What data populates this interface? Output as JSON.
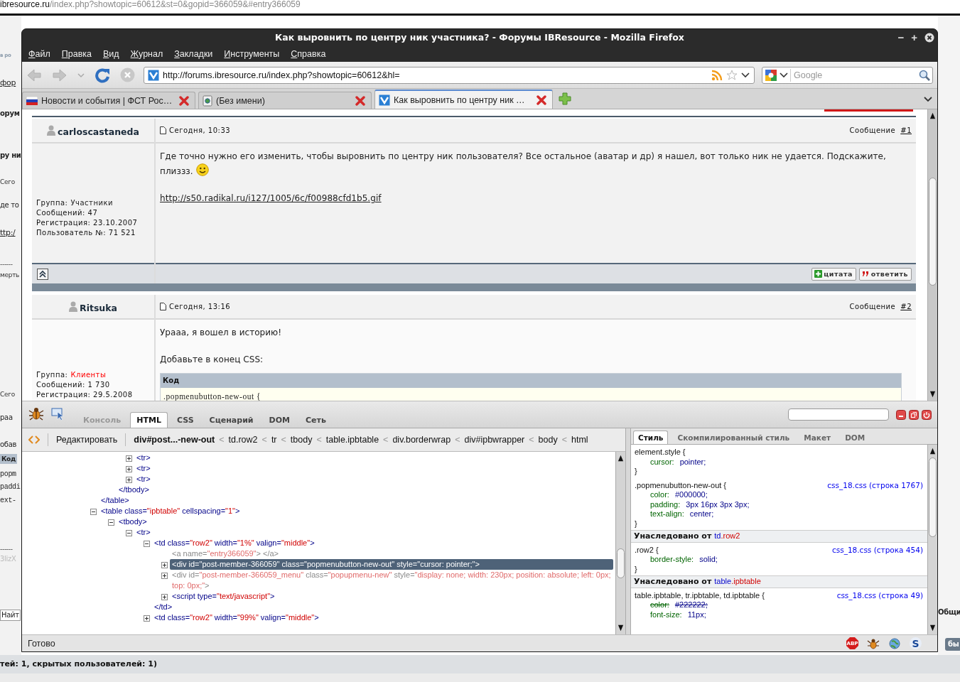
{
  "background_page": {
    "address": {
      "host": "ibresource.ru",
      "path": "/index.php?showtopic=60612&st=0&gopid=366059&#entry366059"
    },
    "left_fragments": [
      {
        "kind": "logo",
        "text": "в ро"
      },
      {
        "kind": "link",
        "text": "фор"
      },
      {
        "kind": "heading",
        "text": "орум"
      },
      {
        "kind": "heading",
        "text": "ру ни"
      },
      {
        "kind": "small",
        "text": "Сего"
      },
      {
        "kind": "text",
        "text": "де то"
      },
      {
        "kind": "link",
        "text": "ttp:/"
      },
      {
        "kind": "small",
        "text": "------"
      },
      {
        "kind": "small",
        "text": "мерть"
      },
      {
        "kind": "small",
        "text": "Сего"
      },
      {
        "kind": "text",
        "text": "раа"
      },
      {
        "kind": "text",
        "text": "обав"
      },
      {
        "kind": "codehead",
        "text": "Код"
      },
      {
        "kind": "mono",
        "text": "popm"
      },
      {
        "kind": "mono",
        "text": "paddi"
      },
      {
        "kind": "mono",
        "text": "ext-"
      },
      {
        "kind": "small",
        "text": "------"
      },
      {
        "kind": "faint",
        "text": "3lizX"
      },
      {
        "kind": "field",
        "text": "Найт"
      }
    ],
    "right_fragments": [
      {
        "kind": "heading",
        "text": "Общи"
      },
      {
        "kind": "button",
        "text": "бы"
      }
    ],
    "footer_text": "тей: 1, скрытых пользователей: 1)"
  },
  "window": {
    "title": "Как выровнить по центру ник участника? - Форумы IBResource - Mozilla Firefox",
    "controls": [
      "−",
      "+"
    ]
  },
  "menu": [
    "Файл",
    "Правка",
    "Вид",
    "Журнал",
    "Закладки",
    "Инструменты",
    "Справка"
  ],
  "toolbar": {
    "nav_buttons": [
      {
        "kind": "back",
        "disabled": true
      },
      {
        "kind": "forward",
        "disabled": true
      },
      {
        "kind": "history",
        "disabled": true
      },
      {
        "kind": "reload",
        "disabled": false
      },
      {
        "kind": "stop",
        "disabled": true
      }
    ],
    "url": "http://forums.ibresource.ru/index.php?showtopic=60612&hl=",
    "search": {
      "placeholder": "Google"
    }
  },
  "tabs": [
    {
      "kind": "flag",
      "label": "Новости и события | ФСТ Рос…",
      "selected": false
    },
    {
      "kind": "page",
      "label": "(Без имени)",
      "selected": false
    },
    {
      "kind": "site",
      "label": "Как выровнить по центру ник …",
      "selected": true
    }
  ],
  "forum": {
    "posts": [
      {
        "author": "carloscastaneda",
        "time": "Сегодня, 10:33",
        "number_label": "Сообщение",
        "number": "#1",
        "group": {
          "label": "Группа:",
          "value": "Участники",
          "color": "#222222"
        },
        "stats": [
          "Сообщений: 47",
          "Регистрация: 23.10.2007",
          "Пользователь №: 71 521"
        ],
        "body": [
          {
            "kind": "text",
            "text": "Где точно нужно его изменить, чтобы выровнить по центру ник пользователя? Все остальное (аватар и др) я нашел, вот только ник не удается. Подскажите, плиззз.",
            "smiley": true
          },
          {
            "kind": "link",
            "text": "http://s50.radikal.ru/i127/1005/6c/f00988cfd1b5.gif"
          }
        ],
        "actions": [
          {
            "kind": "quote",
            "label": "цитата"
          },
          {
            "kind": "reply",
            "label": "ответить"
          }
        ]
      },
      {
        "author": "Ritsuka",
        "time": "Сегодня, 13:16",
        "number_label": "Сообщение",
        "number": "#2",
        "group": {
          "label": "Группа:",
          "value": "Клиенты",
          "color": "#ff0000"
        },
        "stats": [
          "Сообщений: 1 730",
          "Регистрация: 29.5.2008"
        ],
        "body": [
          {
            "kind": "text",
            "text": "Урааа, я вошел в историю!"
          },
          {
            "kind": "text",
            "text": "Добавьте в конец CSS:"
          },
          {
            "kind": "code",
            "title": "Код",
            "lines": [
              ".popmenubutton-new-out {"
            ]
          }
        ]
      }
    ]
  },
  "firebug": {
    "tabs": [
      {
        "label": "Консоль",
        "selected": false,
        "disabled": true
      },
      {
        "label": "HTML",
        "selected": true,
        "disabled": false
      },
      {
        "label": "CSS",
        "selected": false,
        "disabled": false
      },
      {
        "label": "Сценарий",
        "selected": false,
        "disabled": false
      },
      {
        "label": "DOM",
        "selected": false,
        "disabled": false
      },
      {
        "label": "Сеть",
        "selected": false,
        "disabled": false
      }
    ],
    "edit_button": "Редактировать",
    "breadcrumbs": [
      {
        "label": "div#post...-new-out",
        "selected": true,
        "separator": "<"
      },
      {
        "label": "td.row2",
        "selected": false,
        "separator": "<"
      },
      {
        "label": "tr",
        "selected": false,
        "separator": "<"
      },
      {
        "label": "tbody",
        "selected": false,
        "separator": "<"
      },
      {
        "label": "table.ipbtable",
        "selected": false,
        "separator": "<"
      },
      {
        "label": "div.borderwrap",
        "selected": false,
        "separator": "<"
      },
      {
        "label": "div#ipbwrapper",
        "selected": false,
        "separator": "<"
      },
      {
        "label": "body",
        "selected": false,
        "separator": "<"
      },
      {
        "label": "html",
        "selected": false
      }
    ],
    "tree": [
      {
        "kind": "scrolled",
        "children": [
          {
            "kind": "scrolled",
            "children": [
              {
                "kind": "tag",
                "text": "<tr>",
                "expanded": false,
                "selected": false
              },
              {
                "kind": "tag",
                "text": "<tr>",
                "expanded": false,
                "selected": false
              },
              {
                "kind": "tag",
                "text": "<tr>",
                "expanded": false,
                "selected": false
              }
            ]
          },
          {
            "kind": "tag",
            "text": "</tbody>",
            "selected": false
          }
        ]
      },
      {
        "kind": "tag",
        "text": "</table>",
        "selected": false
      },
      {
        "kind": "tag",
        "text": "<table class=\"ipbtable\" cellspacing=\"1\">",
        "expanded": true,
        "selected": false,
        "children": [
          {
            "kind": "tag",
            "text": "<tbody>",
            "expanded": true,
            "selected": false,
            "children": [
              {
                "kind": "tag",
                "text": "<tr>",
                "expanded": true,
                "selected": false,
                "children": [
                  {
                    "kind": "tag",
                    "text": "<td class=\"row2\" width=\"1%\" valign=\"middle\">",
                    "expanded": true,
                    "selected": false,
                    "children": [
                      {
                        "kind": "tag",
                        "text": "<a name=\"entry366059\"> </a>",
                        "selected": false,
                        "dimmed": true
                      },
                      {
                        "kind": "tag",
                        "text": "<div id=\"post-member-366059\" class=\"popmenubutton-new-out\" style=\"cursor: pointer;\">",
                        "expanded": false,
                        "selected": true
                      },
                      {
                        "kind": "tag",
                        "text": "<div id=\"post-member-366059_menu\" class=\"popupmenu-new\" style=\"display: none; width: 230px; position: absolute; left: 0px; top: 0px;\">",
                        "expanded": false,
                        "selected": false,
                        "dimmed": true
                      },
                      {
                        "kind": "tag",
                        "text": "<script type=\"text/javascript\">",
                        "expanded": false,
                        "selected": false
                      }
                    ]
                  },
                  {
                    "kind": "tag",
                    "text": "</td>",
                    "selected": false
                  },
                  {
                    "kind": "tag",
                    "text": "<td class=\"row2\" width=\"99%\" valign=\"middle\">",
                    "expanded": false,
                    "selected": false
                  }
                ]
              }
            ]
          }
        ]
      }
    ],
    "side_tabs": [
      {
        "label": "Стиль",
        "selected": true
      },
      {
        "label": "Скомпилированный стиль",
        "selected": false
      },
      {
        "label": "Макет",
        "selected": false
      },
      {
        "label": "DOM",
        "selected": false
      }
    ],
    "style_rules": [
      {
        "kind": "rule",
        "selector": "element.style {",
        "properties": [
          {
            "name": "cursor:",
            "value": "pointer;",
            "overridden": false
          }
        ],
        "end": "}"
      },
      {
        "kind": "rule",
        "selector": ".popmenubutton-new-out {",
        "source": "css_18.css (строка 1767)",
        "properties": [
          {
            "name": "color:",
            "value": "#000000;",
            "overridden": false
          },
          {
            "name": "padding:",
            "value": "3px 16px 3px 3px;",
            "overridden": false
          },
          {
            "name": "text-align:",
            "value": "center;",
            "overridden": false
          }
        ],
        "end": "}"
      },
      {
        "kind": "inherited",
        "label": "Унаследовано от",
        "element": "td",
        "class": ".row2"
      },
      {
        "kind": "rule",
        "selector": ".row2 {",
        "source": "css_18.css (строка 454)",
        "properties": [
          {
            "name": "border-style:",
            "value": "solid;",
            "overridden": false
          }
        ],
        "end": "}"
      },
      {
        "kind": "inherited",
        "label": "Унаследовано от",
        "element": "table",
        "class": ".ipbtable"
      },
      {
        "kind": "rule",
        "selector": "table.ipbtable, tr.ipbtable, td.ipbtable {",
        "source": "css_18.css (строка 49)",
        "properties": [
          {
            "name": "color:",
            "value": "#222222;",
            "overridden": true
          },
          {
            "name": "font-size:",
            "value": "11px;",
            "overridden": false
          }
        ]
      }
    ]
  },
  "status_bar": {
    "text": "Готово",
    "addons": [
      {
        "kind": "abp",
        "label": "ABP"
      },
      {
        "kind": "bug"
      },
      {
        "kind": "globe"
      },
      {
        "kind": "letter",
        "label": "S"
      }
    ]
  }
}
